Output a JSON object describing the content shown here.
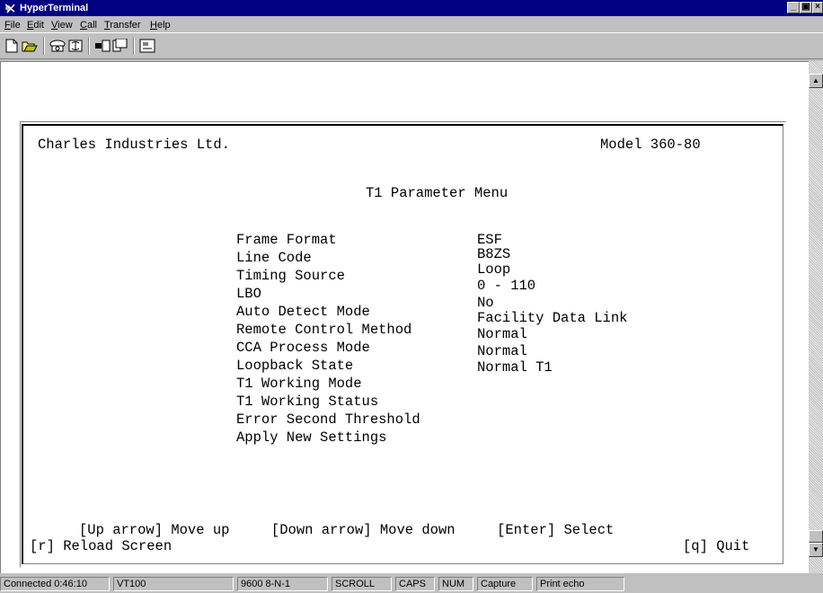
{
  "window": {
    "title": "HyperTerminal"
  },
  "menu": [
    {
      "mnemonic": "F",
      "rest": "ile"
    },
    {
      "mnemonic": "E",
      "rest": "dit"
    },
    {
      "mnemonic": "V",
      "rest": "iew"
    },
    {
      "mnemonic": "C",
      "rest": "all"
    },
    {
      "mnemonic": "T",
      "rest": "ransfer"
    },
    {
      "mnemonic": "H",
      "rest": "elp"
    }
  ],
  "toolbar": {
    "icons": [
      "new-icon",
      "open-icon",
      "connect-icon",
      "disconnect-icon",
      "send-icon",
      "receive-icon",
      "properties-icon"
    ]
  },
  "terminal": {
    "company": "Charles Industries Ltd.",
    "model": "Model 360-80",
    "menu_title": "T1 Parameter Menu",
    "params": [
      {
        "label": "Frame Format",
        "value": "ESF"
      },
      {
        "label": "Line Code",
        "value": "B8ZS"
      },
      {
        "label": "Timing Source",
        "value": "Loop"
      },
      {
        "label": "LBO",
        "value": "0 - 110"
      },
      {
        "label": "Auto Detect Mode",
        "value": "No"
      },
      {
        "label": "Remote Control Method",
        "value": "Facility Data Link"
      },
      {
        "label": "CCA Process Mode",
        "value": "Normal"
      },
      {
        "label": "Loopback State",
        "value": "Normal"
      },
      {
        "label": "T1 Working Mode",
        "value": "Normal T1"
      },
      {
        "label": "T1 Working Status",
        "value": ""
      },
      {
        "label": "Error Second Threshold",
        "value": ""
      },
      {
        "label": "Apply New Settings",
        "value": ""
      }
    ],
    "help_line": "[Up arrow] Move up     [Down arrow] Move down     [Enter] Select",
    "reload": "[r] Reload Screen",
    "quit": "[q] Quit"
  },
  "status": {
    "connected": "Connected 0:46:10",
    "emulation": "VT100",
    "settings": "9600 8-N-1",
    "scroll": "SCROLL",
    "caps": "CAPS",
    "num": "NUM",
    "capture": "Capture",
    "print_echo": "Print echo"
  },
  "colors": {
    "titlebar": "#000080",
    "chrome": "#c0c0c0",
    "terminal_bg": "#ffffff"
  }
}
